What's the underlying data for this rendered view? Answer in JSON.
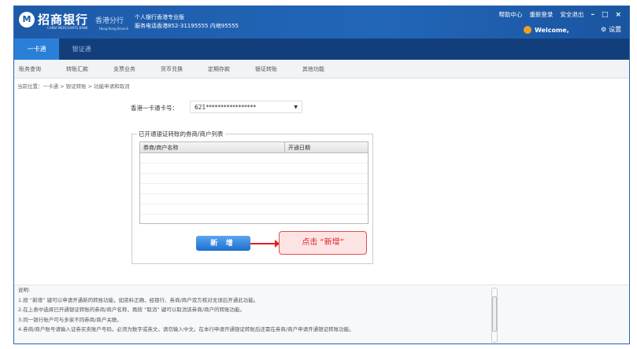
{
  "header": {
    "logo_text": "M",
    "bank_name": "招商银行",
    "bank_name_en": "CHINA MERCHANTS BANK",
    "branch": "香港分行",
    "branch_en": "Hong Kong Branch",
    "version": "个人银行香港专业版",
    "hotline": "服务电话香港852-31195555 内地95555",
    "links": [
      "帮助中心",
      "重新登录",
      "安全退出"
    ],
    "minimize": "–",
    "maximize": "□",
    "close": "×",
    "welcome": "Welcome,",
    "settings": "设置",
    "settings_icon": "⚙"
  },
  "tabs": [
    "一卡通",
    "银证通"
  ],
  "submenu": [
    "账务查询",
    "转账汇款",
    "支票业务",
    "货币兑换",
    "定期存款",
    "银证转账",
    "其他功能"
  ],
  "breadcrumb": "当前位置：一卡通 > 银证转账 > 功能申请和取消",
  "form": {
    "card_label": "香港一卡通卡号：",
    "card_value": "621*****************",
    "dropdown_arrow": "▼"
  },
  "list": {
    "legend": "已开通银证转账的券商/商户列表",
    "columns": [
      "券商/商户名称",
      "开通日期"
    ],
    "rows": []
  },
  "add_button": "新 增",
  "callout": "点击 “新增”",
  "notes": {
    "title": "说明:",
    "items": [
      "1.按 “新增” 键可以申请开通新的转账功能，如资料正确，经银行、券商/商户双方核对无误后开通此功能。",
      "2.在上表中选择已开通银证转账的券商/商户名称，再按 “取消” 键可以取消该券商/商户的转账功能。",
      "3.同一银行账户可与多家不同券商/商户关联。",
      "4.券商/商户账号请输入证券买卖账户号码，必须为数字或英文，请勿输入中文。在本行申请开通银证转账后还需在券商/商户申请开通银证转账功能。"
    ]
  }
}
